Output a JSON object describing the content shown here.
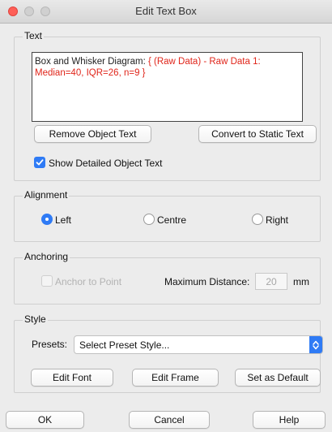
{
  "window": {
    "title": "Edit Text Box"
  },
  "text_group": {
    "label": "Text",
    "content_plain": "Box and Whisker Diagram: ",
    "content_highlight": "{ (Raw Data) - Raw Data 1: Median=40, IQR=26, n=9 }",
    "remove_label": "Remove Object Text",
    "convert_label": "Convert to Static Text",
    "show_detailed_label": "Show Detailed Object Text",
    "show_detailed_checked": true
  },
  "alignment": {
    "label": "Alignment",
    "options": [
      "Left",
      "Centre",
      "Right"
    ],
    "selected": "Left"
  },
  "anchoring": {
    "label": "Anchoring",
    "anchor_label": "Anchor to Point",
    "max_distance_label": "Maximum Distance:",
    "max_distance_value": "20",
    "unit": "mm"
  },
  "style": {
    "label": "Style",
    "presets_label": "Presets:",
    "presets_value": "Select Preset Style...",
    "edit_font_label": "Edit Font",
    "edit_frame_label": "Edit Frame",
    "set_default_label": "Set as Default"
  },
  "footer": {
    "ok_label": "OK",
    "cancel_label": "Cancel",
    "help_label": "Help"
  },
  "colors": {
    "accent": "#2f7bf5",
    "highlight_text": "#e0251a",
    "close_button": "#fe5f57"
  }
}
